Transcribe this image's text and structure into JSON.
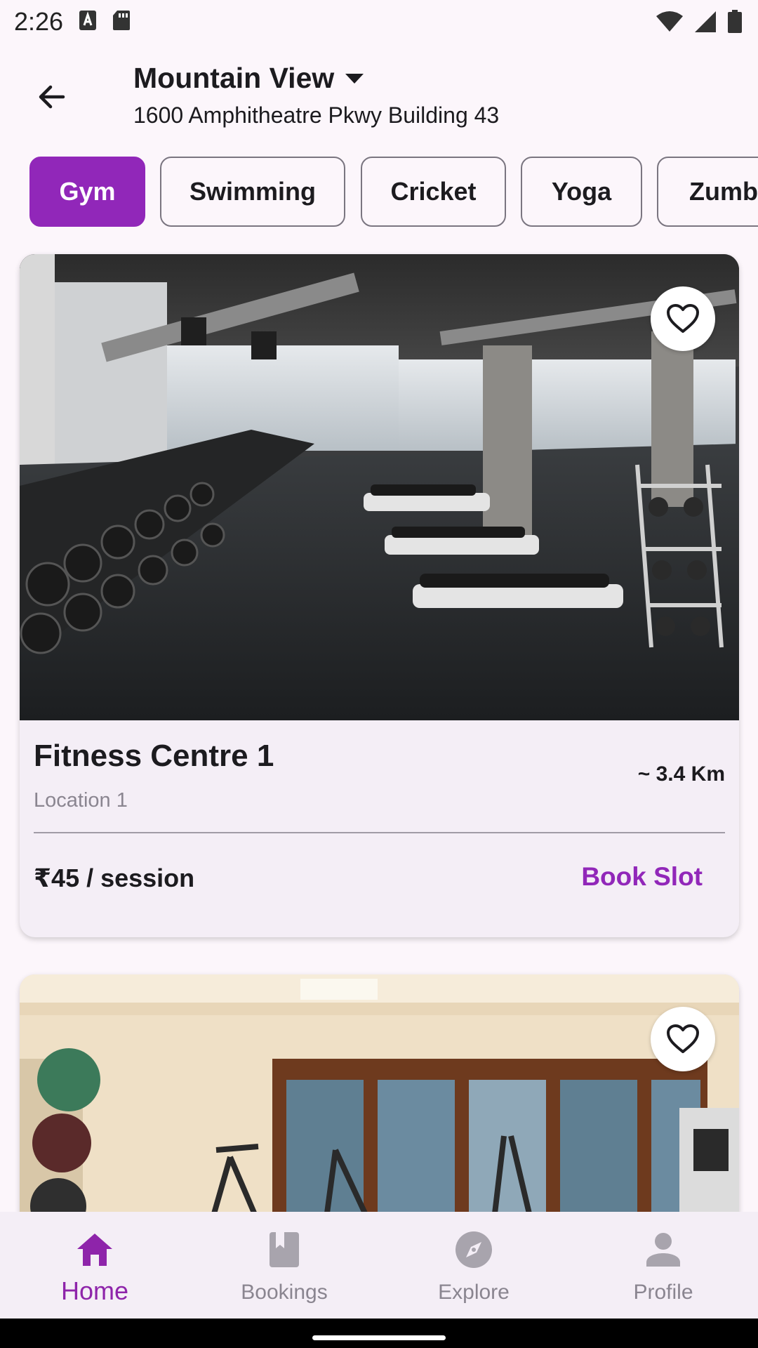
{
  "status_bar": {
    "time": "2:26"
  },
  "header": {
    "location_title": "Mountain View",
    "address": "1600 Amphitheatre Pkwy Building 43"
  },
  "categories": [
    {
      "label": "Gym",
      "active": true
    },
    {
      "label": "Swimming",
      "active": false
    },
    {
      "label": "Cricket",
      "active": false
    },
    {
      "label": "Yoga",
      "active": false
    },
    {
      "label": "Zumba",
      "active": false
    }
  ],
  "cards": [
    {
      "title": "Fitness Centre 1",
      "location": "Location 1",
      "distance": "~ 3.4 Km",
      "price": "₹45 / session",
      "action": "Book Slot"
    }
  ],
  "bottom_nav": [
    {
      "label": "Home",
      "icon": "home-icon",
      "active": true
    },
    {
      "label": "Bookings",
      "icon": "bookmark-icon",
      "active": false
    },
    {
      "label": "Explore",
      "icon": "compass-icon",
      "active": false
    },
    {
      "label": "Profile",
      "icon": "person-icon",
      "active": false
    }
  ],
  "colors": {
    "accent": "#9127b9",
    "background": "#fcf6fb",
    "card": "#f4eef6"
  }
}
